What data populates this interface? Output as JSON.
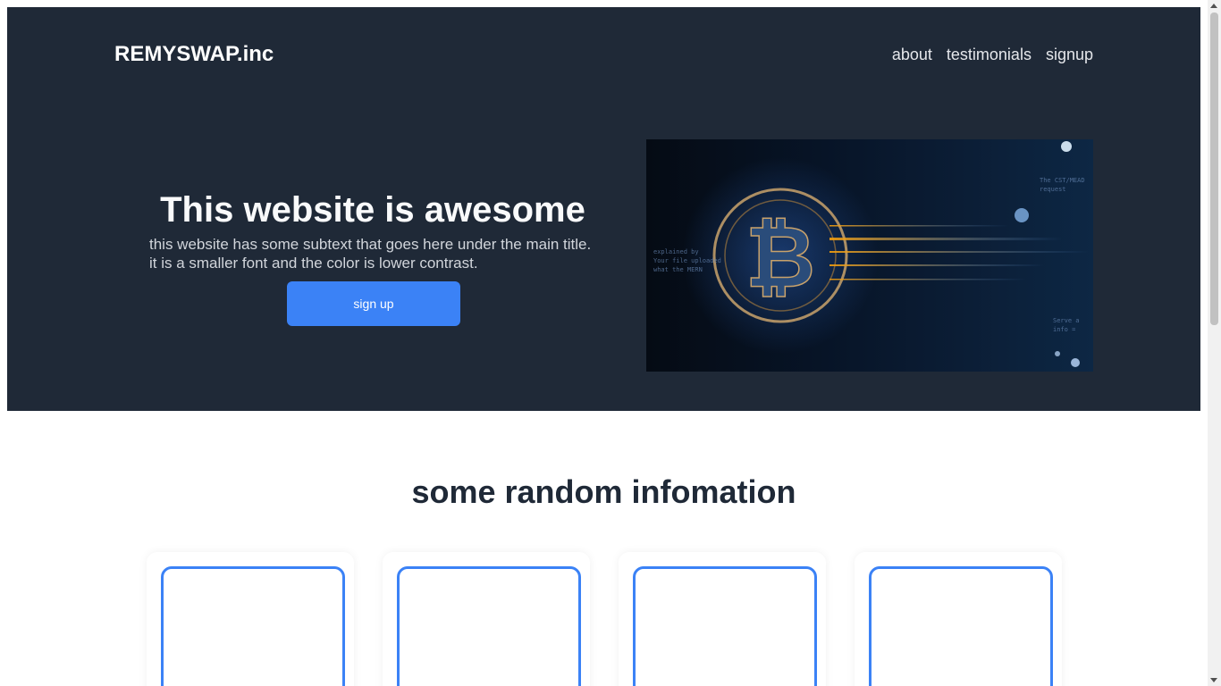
{
  "header": {
    "brand": "REMYSWAP.inc",
    "nav": [
      "about",
      "testimonials",
      "signup"
    ]
  },
  "hero": {
    "title": "This website is awesome",
    "subtitle": "this website has some subtext that goes here under the main title. it is a smaller font and the color is lower contrast.",
    "button_label": "sign up",
    "image": "bitcoin-digital-illustration"
  },
  "info": {
    "title": "some random infomation",
    "card_count": 4
  },
  "colors": {
    "hero_bg": "#1f2937",
    "accent": "#3b82f6",
    "title_dark": "#1f2937"
  }
}
